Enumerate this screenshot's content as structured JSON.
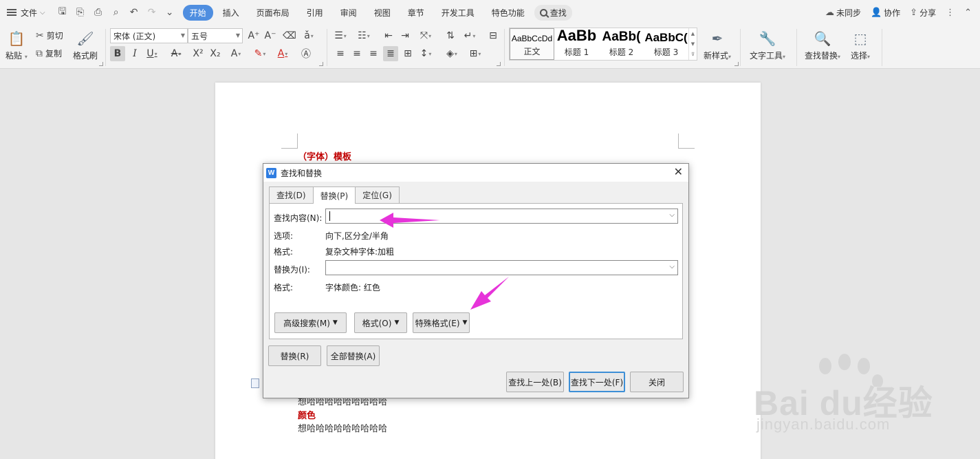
{
  "menubar": {
    "file_label": "文件",
    "tabs": [
      "开始",
      "插入",
      "页面布局",
      "引用",
      "审阅",
      "视图",
      "章节",
      "开发工具",
      "特色功能"
    ],
    "search_label": "查找",
    "right": {
      "sync": "未同步",
      "collab": "协作",
      "share": "分享"
    }
  },
  "ribbon": {
    "paste": "粘贴",
    "cut": "剪切",
    "copy": "复制",
    "format_painter": "格式刷",
    "font_name": "宋体 (正文)",
    "font_size": "五号",
    "styles": [
      {
        "preview": "AaBbCcDd",
        "caption": "正文"
      },
      {
        "preview": "AaBb",
        "caption": "标题 1"
      },
      {
        "preview": "AaBb(",
        "caption": "标题 2"
      },
      {
        "preview": "AaBbC(",
        "caption": "标题 3"
      }
    ],
    "new_style": "新样式",
    "text_tools": "文字工具",
    "find_replace": "查找替换",
    "select": "选择"
  },
  "document": {
    "heading": "（字体）模板",
    "line1": "想哈哈哈哈哈哈哈哈哈",
    "heading2": "颜色",
    "line2": "想哈哈哈哈哈哈哈哈哈"
  },
  "dialog": {
    "title": "查找和替换",
    "tabs": [
      "查找(D)",
      "替换(P)",
      "定位(G)"
    ],
    "find_label": "查找内容(N):",
    "find_value": "",
    "options_label": "选项:",
    "options_value": "向下,区分全/半角",
    "format_label": "格式:",
    "format_value": "复杂文种字体:加粗",
    "replace_label": "替换为(I):",
    "replace_value": "",
    "format2_label": "格式:",
    "format2_value": "字体颜色: 红色",
    "adv_search": "高级搜索(M)",
    "format_btn": "格式(O)",
    "special_btn": "特殊格式(E)",
    "replace_btn": "替换(R)",
    "replace_all_btn": "全部替换(A)",
    "find_prev": "查找上一处(B)",
    "find_next": "查找下一处(F)",
    "close_btn": "关闭"
  },
  "colors": {
    "accent": "#4f8ee0",
    "doc_red": "#c00000",
    "arrow": "#e633d9"
  },
  "watermark": {
    "line1": "Bai du经验",
    "line2": "jingyan.baidu.com"
  }
}
